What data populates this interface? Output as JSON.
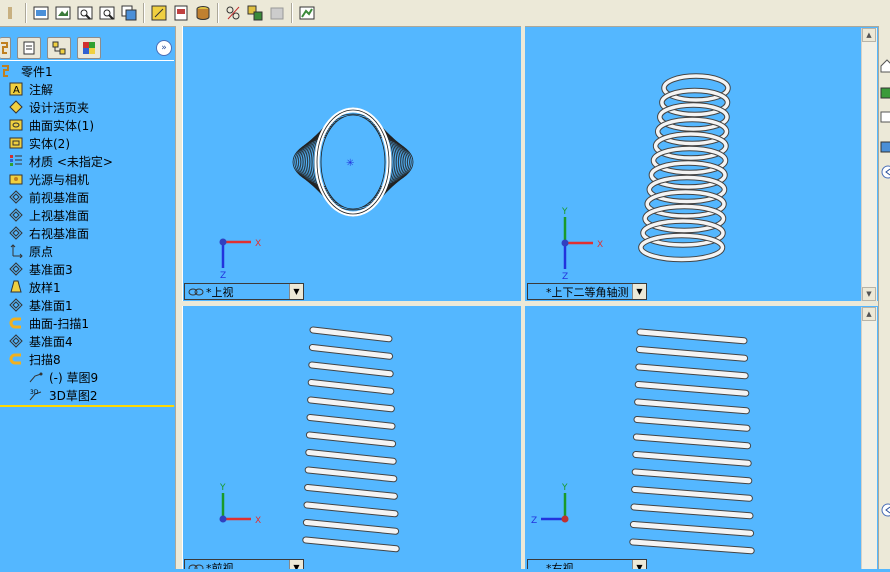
{
  "toolbar": {
    "buttons": [
      "pan-icon",
      "zoom-to-fit-icon",
      "zoom-to-area-icon",
      "zoom-in-out-icon",
      "zoom-to-selection-icon",
      "standard-views-icon",
      "display-style-icon",
      "section-view-icon",
      "hide-show-icon",
      "sketch-icon",
      "appearance-icon",
      "scene-icon",
      "render-icon"
    ]
  },
  "feature_manager": {
    "tabs": [
      "feature-tree-tab-icon",
      "property-manager-tab-icon",
      "configuration-manager-tab-icon",
      "display-manager-tab-icon"
    ],
    "tree": [
      {
        "label": "零件1",
        "icon": "part-icon",
        "indent": 0
      },
      {
        "label": "注解",
        "icon": "annotations-icon",
        "indent": 1
      },
      {
        "label": "设计活页夹",
        "icon": "design-binder-icon",
        "indent": 1
      },
      {
        "label": "曲面实体(1)",
        "icon": "surface-bodies-icon",
        "indent": 1
      },
      {
        "label": "实体(2)",
        "icon": "solid-bodies-icon",
        "indent": 1
      },
      {
        "label": "材质 <未指定>",
        "icon": "material-icon",
        "indent": 1
      },
      {
        "label": "光源与相机",
        "icon": "lights-cameras-icon",
        "indent": 1
      },
      {
        "label": "前视基准面",
        "icon": "plane-icon",
        "indent": 1
      },
      {
        "label": "上视基准面",
        "icon": "plane-icon",
        "indent": 1
      },
      {
        "label": "右视基准面",
        "icon": "plane-icon",
        "indent": 1
      },
      {
        "label": "原点",
        "icon": "origin-icon",
        "indent": 1
      },
      {
        "label": "基准面3",
        "icon": "plane-icon",
        "indent": 1
      },
      {
        "label": "放样1",
        "icon": "loft-icon",
        "indent": 1
      },
      {
        "label": "基准面1",
        "icon": "plane-icon",
        "indent": 1
      },
      {
        "label": "曲面-扫描1",
        "icon": "surface-sweep-icon",
        "indent": 1
      },
      {
        "label": "基准面4",
        "icon": "plane-icon",
        "indent": 1
      },
      {
        "label": "扫描8",
        "icon": "sweep-icon",
        "indent": 1
      },
      {
        "label": "(-) 草图9",
        "icon": "sketch-icon",
        "indent": 2
      },
      {
        "label": "3D草图2",
        "icon": "sketch-3d-icon",
        "indent": 2
      }
    ]
  },
  "viewports": {
    "top": {
      "label": "*上视",
      "axes": [
        "X",
        "Z"
      ]
    },
    "iso": {
      "label": "*上下二等角轴测",
      "axes": [
        "Y",
        "X",
        "Z"
      ]
    },
    "front": {
      "label": "*前视",
      "axes": [
        "Y",
        "X"
      ]
    },
    "right": {
      "label": "*右视",
      "axes": [
        "Y",
        "Z"
      ]
    }
  },
  "colors": {
    "viewport_bg": "#54b7ff",
    "panel_bg": "#ece9d8",
    "axis_x": "#e03030",
    "axis_y": "#1a9a2a",
    "axis_z": "#2233dd",
    "spring": "#f4f4f4"
  }
}
